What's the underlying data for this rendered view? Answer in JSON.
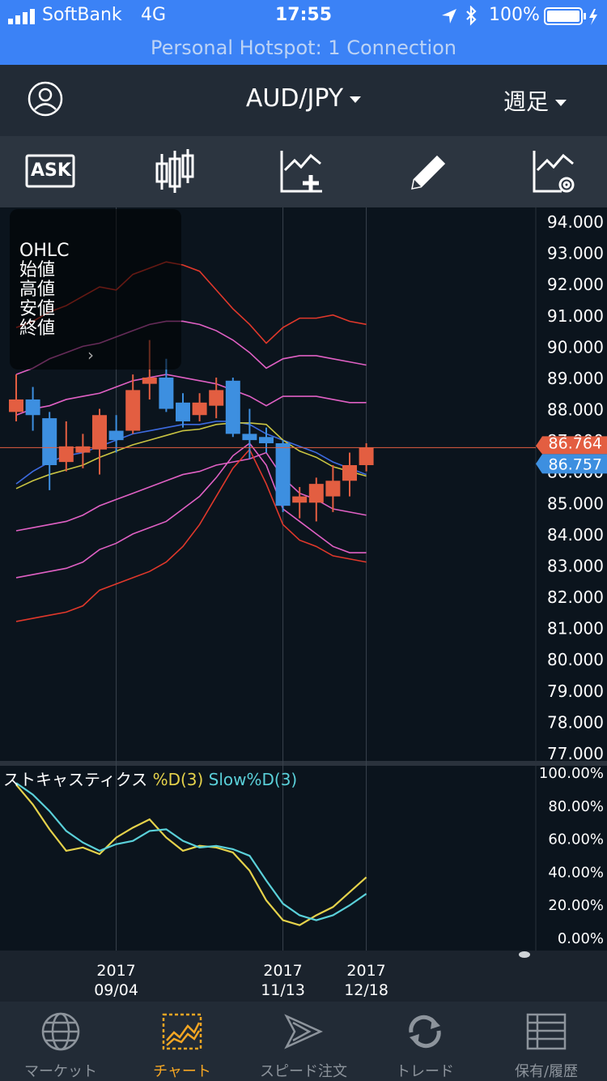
{
  "status": {
    "carrier": "SoftBank",
    "network": "4G",
    "time": "17:55",
    "battery": "100%",
    "hotspot": "Personal Hotspot: 1 Connection"
  },
  "header": {
    "pair": "AUD/JPY",
    "period": "週足"
  },
  "toolbar": {
    "ask_label": "ASK",
    "icons": [
      "ask-icon",
      "candlestick-icon",
      "add-indicator-icon",
      "pencil-icon",
      "indicator-settings-icon"
    ]
  },
  "ohlc_panel": {
    "title": "OHLC",
    "open_label": "始値",
    "high_label": "高値",
    "low_label": "安値",
    "close_label": "終値"
  },
  "chart_data": [
    {
      "type": "candlestick",
      "symbol": "AUD/JPY",
      "y_ticks": [
        "94.000",
        "93.000",
        "92.000",
        "91.000",
        "90.000",
        "89.000",
        "88.000",
        "87.000",
        "86.000",
        "85.000",
        "84.000",
        "83.000",
        "82.000",
        "81.000",
        "80.000",
        "79.000",
        "78.000",
        "77.000"
      ],
      "ylim": [
        77.0,
        94.0
      ],
      "x_ticks": [
        {
          "year": "2017",
          "date": "09/04",
          "index": 6
        },
        {
          "year": "2017",
          "date": "11/13",
          "index": 16
        },
        {
          "year": "2017",
          "date": "12/18",
          "index": 21
        }
      ],
      "price_tags": {
        "ask": "86.764",
        "bid": "86.757"
      },
      "current_price": 86.76,
      "candles": [
        {
          "o": 87.9,
          "c": 88.3,
          "h": 89.1,
          "l": 87.6
        },
        {
          "o": 88.3,
          "c": 87.8,
          "h": 88.7,
          "l": 87.3
        },
        {
          "o": 87.7,
          "c": 86.2,
          "h": 87.9,
          "l": 85.4
        },
        {
          "o": 86.3,
          "c": 86.8,
          "h": 87.6,
          "l": 86.0
        },
        {
          "o": 86.6,
          "c": 86.8,
          "h": 87.2,
          "l": 86.1
        },
        {
          "o": 86.7,
          "c": 87.8,
          "h": 88.0,
          "l": 85.9
        },
        {
          "o": 87.3,
          "c": 87.0,
          "h": 87.8,
          "l": 86.6
        },
        {
          "o": 87.3,
          "c": 88.6,
          "h": 89.1,
          "l": 87.2
        },
        {
          "o": 88.8,
          "c": 89.0,
          "h": 90.2,
          "l": 88.3
        },
        {
          "o": 89.0,
          "c": 88.0,
          "h": 89.6,
          "l": 87.9
        },
        {
          "o": 88.2,
          "c": 87.6,
          "h": 88.5,
          "l": 87.4
        },
        {
          "o": 87.8,
          "c": 88.2,
          "h": 88.5,
          "l": 87.6
        },
        {
          "o": 88.1,
          "c": 88.6,
          "h": 89.0,
          "l": 87.7
        },
        {
          "o": 88.9,
          "c": 87.2,
          "h": 89.0,
          "l": 87.1
        },
        {
          "o": 87.2,
          "c": 87.0,
          "h": 88.0,
          "l": 86.4
        },
        {
          "o": 87.1,
          "c": 86.9,
          "h": 87.4,
          "l": 86.6
        },
        {
          "o": 86.9,
          "c": 84.9,
          "h": 87.0,
          "l": 84.7
        },
        {
          "o": 85.0,
          "c": 85.2,
          "h": 85.5,
          "l": 84.5
        },
        {
          "o": 85.0,
          "c": 85.6,
          "h": 85.8,
          "l": 84.4
        },
        {
          "o": 85.2,
          "c": 85.7,
          "h": 86.2,
          "l": 84.7
        },
        {
          "o": 85.7,
          "c": 86.2,
          "h": 86.6,
          "l": 85.2
        },
        {
          "o": 86.2,
          "c": 86.76,
          "h": 86.9,
          "l": 86.0
        }
      ],
      "bollinger_bands": {
        "upper3": [
          90.6,
          90.8,
          91.1,
          91.3,
          91.6,
          91.9,
          91.8,
          92.3,
          92.5,
          92.7,
          92.6,
          92.4,
          91.8,
          91.2,
          90.7,
          90.1,
          90.6,
          90.9,
          90.9,
          91.0,
          90.8,
          90.7
        ],
        "upper2": [
          89.1,
          89.3,
          89.6,
          89.8,
          90.0,
          90.1,
          90.3,
          90.5,
          90.7,
          90.8,
          90.8,
          90.7,
          90.5,
          90.2,
          89.8,
          89.3,
          89.6,
          89.7,
          89.7,
          89.6,
          89.5,
          89.4
        ],
        "upper1": [
          87.8,
          88.0,
          88.1,
          88.3,
          88.4,
          88.5,
          88.7,
          88.9,
          89.0,
          89.1,
          89.0,
          88.9,
          88.8,
          88.6,
          88.4,
          88.1,
          88.4,
          88.4,
          88.4,
          88.3,
          88.2,
          88.2
        ],
        "middle": [
          85.6,
          86.0,
          86.3,
          86.5,
          86.6,
          86.8,
          87.0,
          87.2,
          87.3,
          87.4,
          87.5,
          87.5,
          87.6,
          87.6,
          87.5,
          87.2,
          87.0,
          86.8,
          86.6,
          86.3,
          86.1,
          85.9
        ],
        "lower1": [
          84.1,
          84.2,
          84.3,
          84.4,
          84.6,
          84.9,
          85.1,
          85.3,
          85.5,
          85.7,
          85.9,
          86.0,
          86.2,
          86.3,
          86.4,
          86.6,
          85.8,
          85.3,
          85.1,
          84.8,
          84.7,
          84.6
        ],
        "lower2": [
          82.6,
          82.7,
          82.8,
          82.9,
          83.1,
          83.5,
          83.7,
          84.0,
          84.2,
          84.4,
          84.8,
          85.2,
          85.8,
          86.5,
          86.9,
          86.2,
          84.8,
          84.4,
          84.0,
          83.6,
          83.4,
          83.4
        ],
        "lower3": [
          81.2,
          81.3,
          81.4,
          81.5,
          81.7,
          82.2,
          82.4,
          82.6,
          82.8,
          83.1,
          83.6,
          84.3,
          85.2,
          86.1,
          86.7,
          85.6,
          84.3,
          83.8,
          83.6,
          83.3,
          83.2,
          83.1
        ]
      }
    },
    {
      "type": "line",
      "title": "ストキャスティクス",
      "y_ticks": [
        "100.00%",
        "80.00%",
        "60.00%",
        "40.00%",
        "20.00%",
        "0.00%"
      ],
      "ylim": [
        0,
        100
      ],
      "series": [
        {
          "name": "%D(3)",
          "color": "#e5d24b",
          "values": [
            92,
            80,
            65,
            52,
            54,
            50,
            60,
            66,
            71,
            60,
            52,
            55,
            54,
            51,
            40,
            22,
            10,
            7,
            13,
            18,
            27,
            36
          ]
        },
        {
          "name": "Slow%D(3)",
          "color": "#5ad0d9",
          "values": [
            93,
            86,
            76,
            64,
            57,
            52,
            56,
            58,
            64,
            65,
            58,
            54,
            55,
            53,
            49,
            34,
            20,
            13,
            10,
            13,
            19,
            26
          ]
        }
      ]
    }
  ],
  "tabs": [
    {
      "label": "マーケット",
      "icon": "globe-icon",
      "active": false
    },
    {
      "label": "チャート",
      "icon": "chart-icon",
      "active": true
    },
    {
      "label": "スピード注文",
      "icon": "speed-order-icon",
      "active": false
    },
    {
      "label": "トレード",
      "icon": "trade-icon",
      "active": false
    },
    {
      "label": "保有/履歴",
      "icon": "history-icon",
      "active": false
    }
  ],
  "colors": {
    "status_bar": "#3b82f6",
    "up_candle": "#e35e41",
    "down_candle": "#3d8fe0",
    "active_tab": "#f5a623"
  }
}
